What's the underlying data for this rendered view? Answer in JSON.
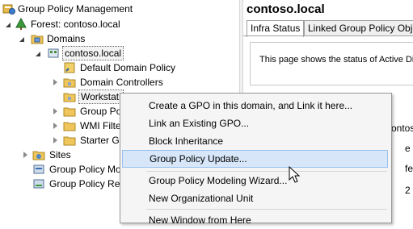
{
  "tree": {
    "root": "Group Policy Management",
    "forest": "Forest: contoso.local",
    "domains": "Domains",
    "domain": "contoso.local",
    "default_policy": "Default Domain Policy",
    "domain_controllers": "Domain Controllers",
    "workstations": "Workstati",
    "group_policy_objects": "Group Po",
    "wmi_filters": "WMI Filte",
    "starter_gpos": "Starter GP",
    "sites": "Sites",
    "modeling": "Group Policy Mo",
    "results": "Group Policy Res"
  },
  "right": {
    "title": "contoso.local",
    "tabs": [
      "Infra Status",
      "Linked Group Policy Objects"
    ],
    "status_text": "This page shows the status of Active Di",
    "fragments": {
      "domain_partial": "ontos",
      "letter_e": "e",
      "fe": "fe",
      "two": "2"
    }
  },
  "context_menu": {
    "items": [
      "Create a GPO in this domain, and Link it here...",
      "Link an Existing GPO...",
      "Block Inheritance",
      "Group Policy Update...",
      "Group Policy Modeling Wizard...",
      "New Organizational Unit",
      "New Window from Here"
    ]
  },
  "colors": {
    "highlight_bg": "#d7e6f8",
    "highlight_border": "#99c1ee",
    "menu_bg": "#f5f5f5"
  }
}
